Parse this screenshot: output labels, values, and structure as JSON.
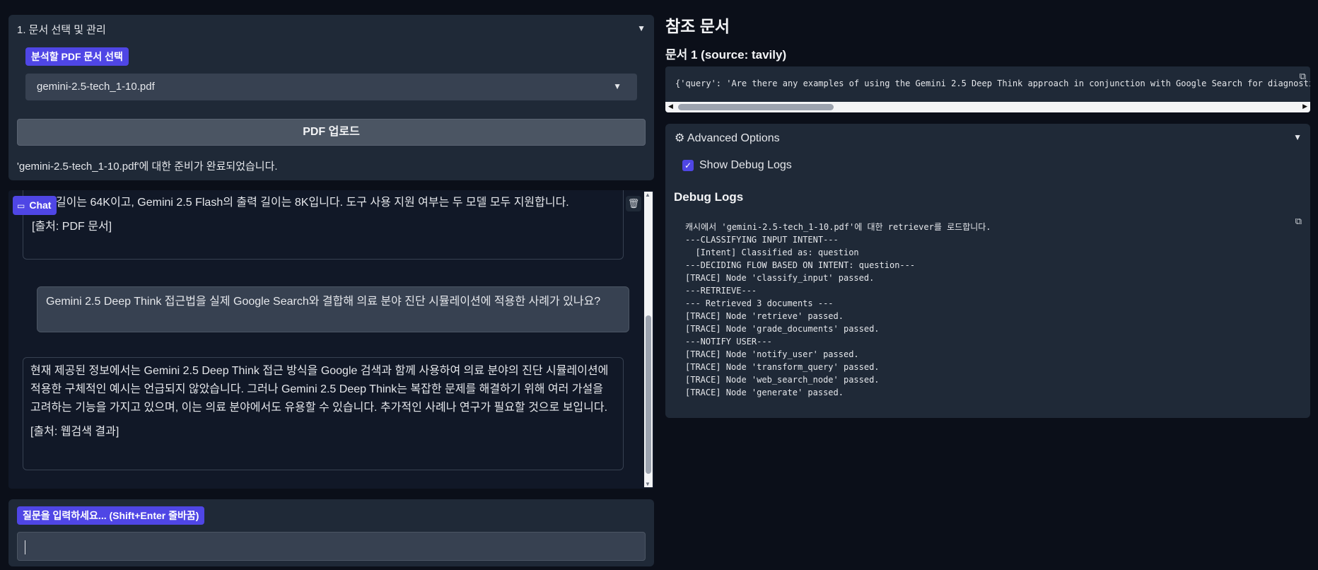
{
  "doc_section": {
    "title": "1. 문서 선택 및 관리",
    "select_label": "분석할 PDF 문서 선택",
    "selected_pdf": "gemini-2.5-tech_1-10.pdf",
    "upload_button": "PDF 업로드",
    "status": "'gemini-2.5-tech_1-10.pdf'에 대한 준비가 완료되었습니다."
  },
  "chat": {
    "label": "Chat",
    "messages": [
      {
        "role": "bot",
        "text": "출력 길이는 64K이고, Gemini 2.5 Flash의 출력 길이는 8K입니다. 도구 사용 지원 여부는 두 모델 모두 지원합니다.",
        "source": "[출처: PDF 문서]"
      },
      {
        "role": "user",
        "text": "Gemini 2.5 Deep Think 접근법을 실제 Google Search와 결합해 의료 분야 진단 시뮬레이션에 적용한 사례가 있나요?"
      },
      {
        "role": "bot",
        "text": "현재 제공된 정보에서는 Gemini 2.5 Deep Think 접근 방식을 Google 검색과 함께 사용하여 의료 분야의 진단 시뮬레이션에 적용한 구체적인 예시는 언급되지 않았습니다. 그러나 Gemini 2.5 Deep Think는 복잡한 문제를 해결하기 위해 여러 가설을 고려하는 기능을 가지고 있으며, 이는 의료 분야에서도 유용할 수 있습니다. 추가적인 사례나 연구가 필요할 것으로 보입니다.",
        "source": "[출처: 웹검색 결과]"
      }
    ]
  },
  "input": {
    "label": "질문을 입력하세요... (Shift+Enter 줄바꿈)",
    "value": ""
  },
  "references": {
    "title": "참조 문서",
    "doc1_title": "문서 1 (source: tavily)",
    "doc1_content": "{'query': 'Are there any examples of using the Gemini 2.5 Deep Think approach in conjunction with Google Search for diagnosti"
  },
  "advanced": {
    "title": "Advanced Options",
    "show_debug_label": "Show Debug Logs",
    "show_debug_checked": true,
    "debug_title": "Debug Logs",
    "logs": [
      "캐시에서 'gemini-2.5-tech_1-10.pdf'에 대한 retriever를 로드합니다.",
      "---CLASSIFYING INPUT INTENT---",
      "  [Intent] Classified as: question",
      "---DECIDING FLOW BASED ON INTENT: question---",
      "[TRACE] Node 'classify_input' passed.",
      "---RETRIEVE---",
      "--- Retrieved 3 documents ---",
      "[TRACE] Node 'retrieve' passed.",
      "[TRACE] Node 'grade_documents' passed.",
      "---NOTIFY USER---",
      "[TRACE] Node 'notify_user' passed.",
      "[TRACE] Node 'transform_query' passed.",
      "[TRACE] Node 'web_search_node' passed.",
      "[TRACE] Node 'generate' passed."
    ]
  },
  "colors": {
    "background": "#0b0f19",
    "panel": "#1f2937",
    "accent": "#4f46e5"
  }
}
